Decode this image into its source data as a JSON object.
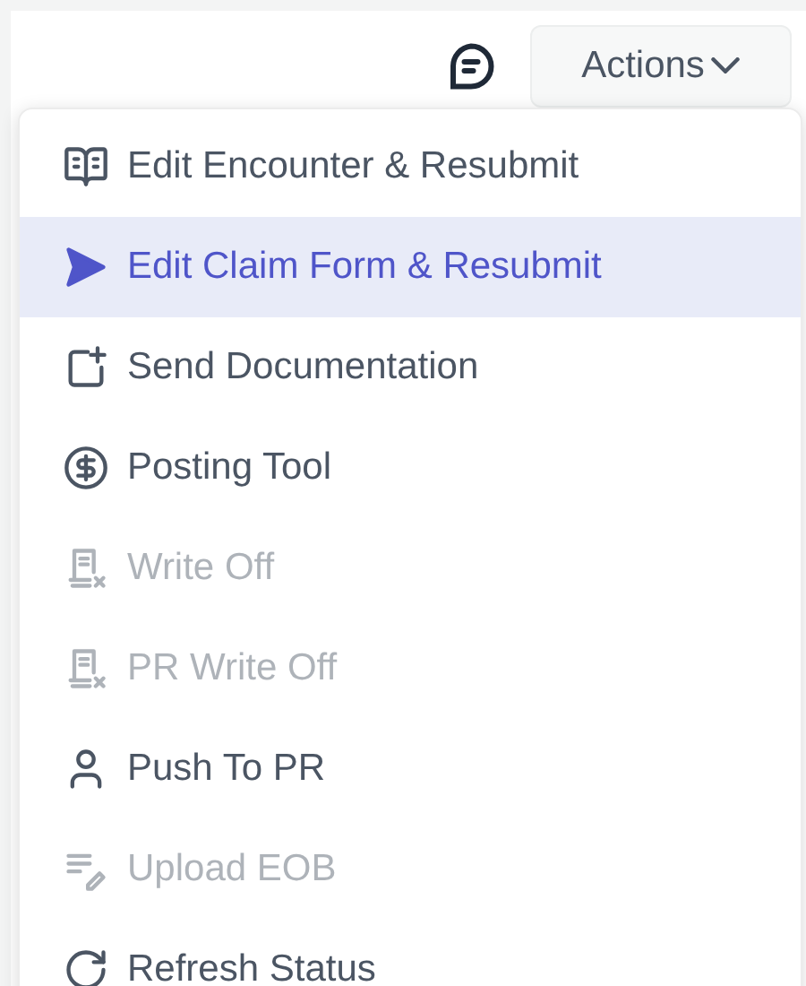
{
  "header": {
    "actions_button": {
      "label": "Actions",
      "expanded": true
    }
  },
  "menu": {
    "items": [
      {
        "kind": "book",
        "label": "Edit Encounter & Resubmit",
        "selected": false,
        "disabled": false
      },
      {
        "kind": "send",
        "label": "Edit Claim Form & Resubmit",
        "selected": true,
        "disabled": false
      },
      {
        "kind": "add-doc",
        "label": "Send Documentation",
        "selected": false,
        "disabled": false
      },
      {
        "kind": "dollar",
        "label": "Posting Tool",
        "selected": false,
        "disabled": false
      },
      {
        "kind": "receipt-x",
        "label": "Write Off",
        "selected": false,
        "disabled": true
      },
      {
        "kind": "receipt-x",
        "label": "PR Write Off",
        "selected": false,
        "disabled": true
      },
      {
        "kind": "user",
        "label": "Push To PR",
        "selected": false,
        "disabled": false
      },
      {
        "kind": "list-edit",
        "label": "Upload EOB",
        "selected": false,
        "disabled": true
      },
      {
        "kind": "refresh",
        "label": "Refresh Status",
        "selected": false,
        "disabled": false
      }
    ]
  }
}
